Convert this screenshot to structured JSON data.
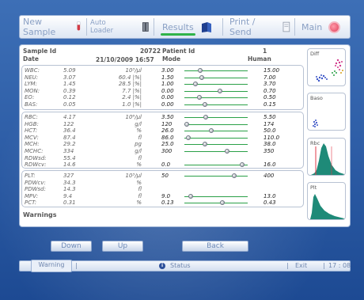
{
  "toolbar": {
    "new_sample": "New Sample",
    "auto_loader": "Auto Loader",
    "results": "Results",
    "print_send": "Print / Send",
    "main": "Main"
  },
  "header": {
    "sample_id_label": "Sample Id",
    "sample_id": "20722",
    "patient_id_label": "Patient Id",
    "patient_id": "1",
    "date_label": "Date",
    "date": "21/10/2009 16:57",
    "mode_label": "Mode",
    "mode": "Human"
  },
  "wbc_group": [
    {
      "name": "WBC:",
      "value": "5.09",
      "unit": "10³/µl",
      "low": "3.00",
      "high": "15.00",
      "level": 0.25
    },
    {
      "name": "NEU:",
      "value": "3.07",
      "unit": "60.4 |%|",
      "low": "1.50",
      "high": "7.00",
      "level": 0.28
    },
    {
      "name": "LYM:",
      "value": "1.45",
      "unit": "28.5 |%|",
      "low": "1.00",
      "high": "3.70",
      "level": 0.17
    },
    {
      "name": "MON:",
      "value": "0.39",
      "unit": "7.7 |%|",
      "low": "0.00",
      "high": "0.70",
      "level": 0.56
    },
    {
      "name": "EO:",
      "value": "0.12",
      "unit": "2.4 |%|",
      "low": "0.00",
      "high": "0.50",
      "level": 0.24
    },
    {
      "name": "BAS:",
      "value": "0.05",
      "unit": "1.0 |%|",
      "low": "0.00",
      "high": "0.15",
      "level": 0.33
    }
  ],
  "rbc_group": [
    {
      "name": "RBC:",
      "value": "4.17",
      "unit": "10⁶/µl",
      "low": "3.50",
      "high": "5.50",
      "level": 0.34
    },
    {
      "name": "HGB:",
      "value": "122",
      "unit": "g/l",
      "low": "120",
      "high": "174",
      "level": 0.04
    },
    {
      "name": "HCT:",
      "value": "36.4",
      "unit": "%",
      "low": "26.0",
      "high": "50.0",
      "level": 0.43
    },
    {
      "name": "MCV:",
      "value": "87.4",
      "unit": "fl",
      "low": "86.0",
      "high": "110.0",
      "level": 0.06
    },
    {
      "name": "MCH:",
      "value": "29.2",
      "unit": "pg",
      "low": "25.0",
      "high": "38.0",
      "level": 0.32
    },
    {
      "name": "MCHC:",
      "value": "334",
      "unit": "g/l",
      "low": "300",
      "high": "350",
      "level": 0.68
    },
    {
      "name": "RDWsd:",
      "value": "55.4",
      "unit": "fl",
      "low": "",
      "high": "",
      "level": null
    },
    {
      "name": "RDWcv:",
      "value": "14.6",
      "unit": "%",
      "low": "0.0",
      "high": "16.0",
      "level": 0.91
    }
  ],
  "plt_group": [
    {
      "name": "PLT:",
      "value": "327",
      "unit": "10³/µl",
      "low": "50",
      "high": "400",
      "level": 0.79
    },
    {
      "name": "PDWcv:",
      "value": "34.3",
      "unit": "%",
      "low": "",
      "high": "",
      "level": null
    },
    {
      "name": "PDWsd:",
      "value": "14.3",
      "unit": "fl",
      "low": "",
      "high": "",
      "level": null
    },
    {
      "name": "MPV:",
      "value": "9.4",
      "unit": "fl",
      "low": "9.0",
      "high": "13.0",
      "level": 0.1
    },
    {
      "name": "PCT:",
      "value": "0.31",
      "unit": "%",
      "low": "0.13",
      "high": "0.43",
      "level": 0.6
    }
  ],
  "warnings_label": "Warnings",
  "thumbs": {
    "diff": "Diff",
    "baso": "Baso",
    "rbc": "Rbc",
    "plt": "Plt"
  },
  "buttons": {
    "down": "Down",
    "up": "Up",
    "back": "Back"
  },
  "statusbar": {
    "warning": "Warning",
    "status": "Status",
    "exit": "Exit",
    "time": "17 : 08"
  },
  "colors": {
    "accent_green": "#30b34a",
    "slider_green": "#2aa047",
    "histogram_teal": "#1e8a78",
    "stop_red": "#e0405c"
  }
}
